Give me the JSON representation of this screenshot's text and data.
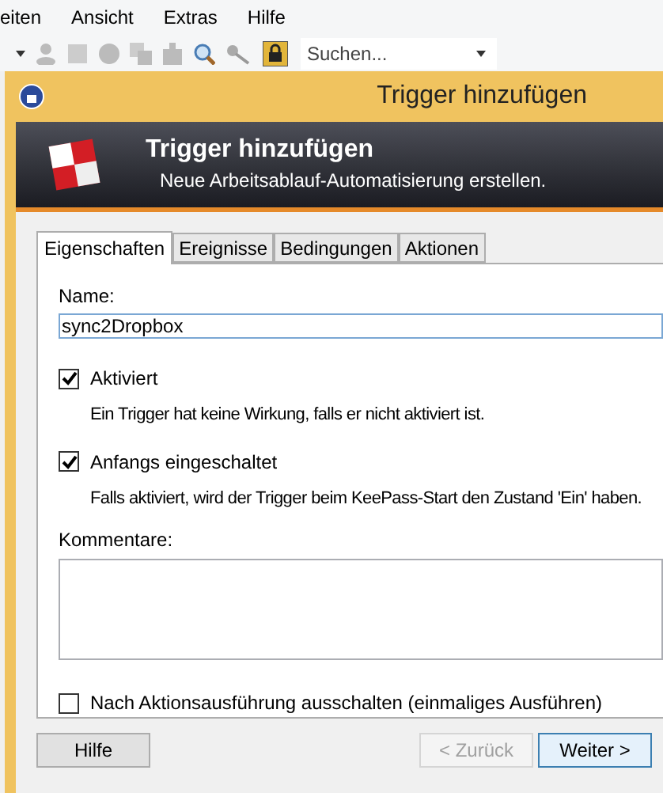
{
  "menu": [
    {
      "label": "eiten"
    },
    {
      "label": "Ansicht"
    },
    {
      "label": "Extras"
    },
    {
      "label": "Hilfe"
    }
  ],
  "toolbar": {
    "search": {
      "placeholder": "Suchen..."
    }
  },
  "window": {
    "title": "Trigger hinzufügen"
  },
  "header": {
    "title": "Trigger hinzufügen",
    "subtitle": "Neue Arbeitsablauf-Automatisierung erstellen."
  },
  "tabs": [
    {
      "label": "Eigenschaften",
      "selected": true
    },
    {
      "label": "Ereignisse",
      "selected": false
    },
    {
      "label": "Bedingungen",
      "selected": false
    },
    {
      "label": "Aktionen",
      "selected": false
    }
  ],
  "name_field": {
    "label": "Name:",
    "value": "sync2Dropbox"
  },
  "options": [
    {
      "label": "Aktiviert",
      "checked": true,
      "description": "Ein Trigger hat keine Wirkung, falls er nicht aktiviert ist."
    },
    {
      "label": "Anfangs eingeschaltet",
      "checked": true,
      "description": "Falls aktiviert, wird der Trigger beim KeePass-Start den Zustand 'Ein' haben."
    }
  ],
  "comments": {
    "label": "Kommentare:"
  },
  "run_once": {
    "label": "Nach Aktionsausführung ausschalten (einmaliges Ausführen)",
    "checked": false
  },
  "buttons": [
    {
      "label": "Hilfe",
      "disabled": false,
      "kind": "left"
    },
    {
      "label": "< Zurück",
      "disabled": true,
      "kind": "right"
    },
    {
      "label": "Weiter >",
      "disabled": false,
      "kind": "right"
    }
  ]
}
